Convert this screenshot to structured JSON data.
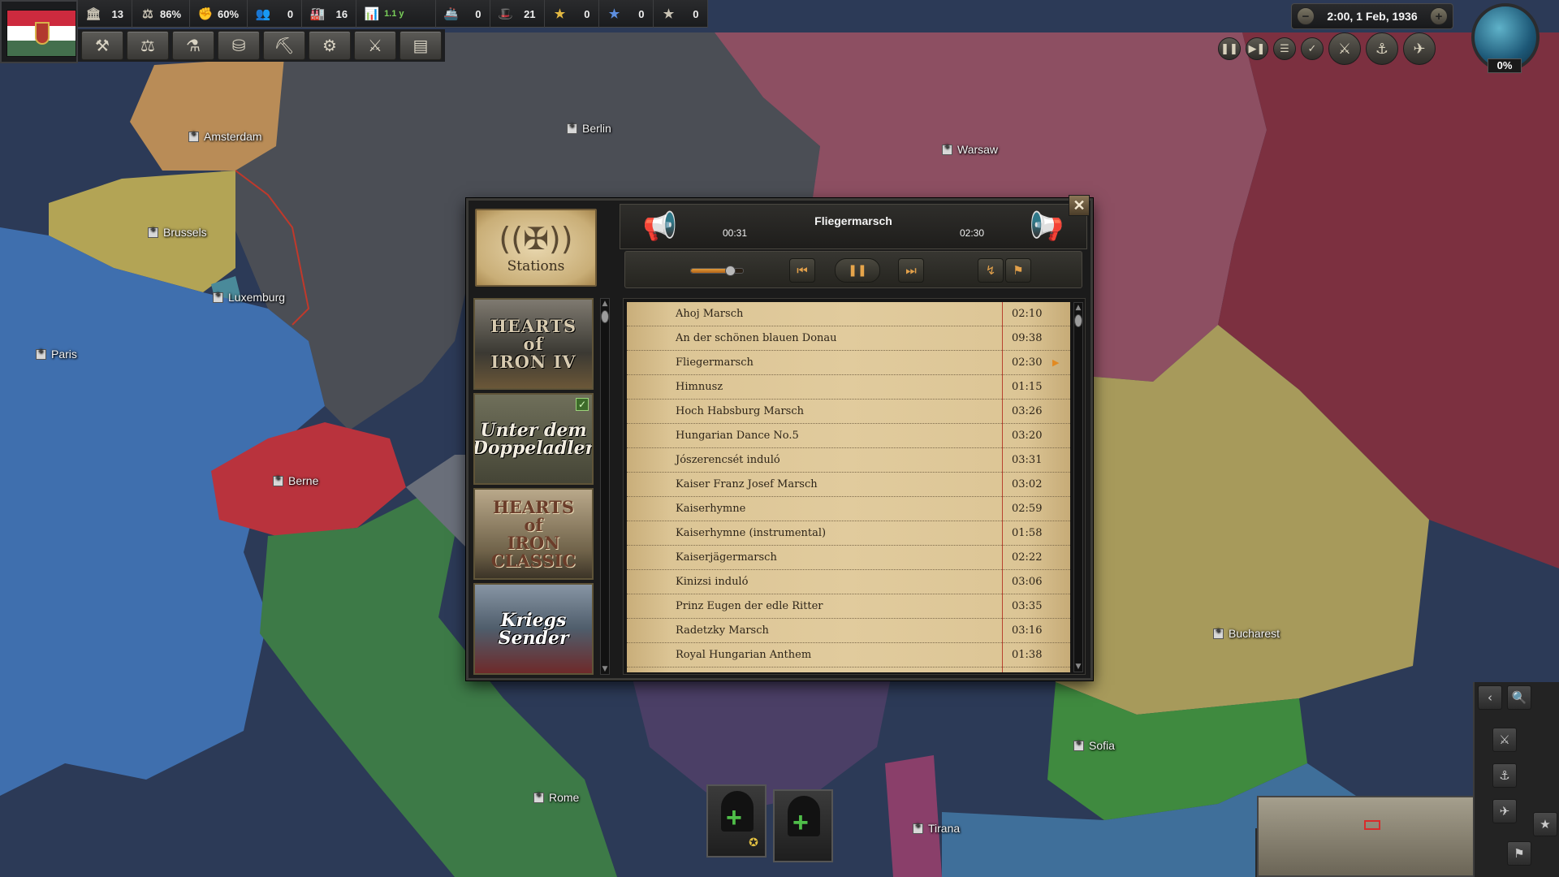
{
  "top_bar": {
    "resources": [
      {
        "name": "political-power",
        "icon": "🏛",
        "value": "13"
      },
      {
        "name": "stability",
        "icon": "⚖",
        "value": "86%"
      },
      {
        "name": "war-support",
        "icon": "✊",
        "value": "60%"
      },
      {
        "name": "manpower",
        "icon": "👥",
        "value": "0"
      },
      {
        "name": "factories",
        "icon": "🏭",
        "value": "16"
      },
      {
        "name": "equipment",
        "icon": "📊",
        "value": "",
        "extra": "1.1 y"
      },
      {
        "name": "convoys",
        "icon": "🚢",
        "value": "0"
      },
      {
        "name": "intelligence",
        "icon": "🎩",
        "value": "21"
      },
      {
        "name": "gold-star",
        "icon": "★",
        "value": "0"
      },
      {
        "name": "blue-star",
        "icon": "★",
        "value": "0"
      },
      {
        "name": "white-star",
        "icon": "★",
        "value": "0"
      }
    ],
    "toolbar_buttons": [
      "hammer-icon",
      "diplomacy-icon",
      "research-icon",
      "trade-icon",
      "construction-icon",
      "production-icon",
      "army-icon",
      "logistics-icon"
    ],
    "date": "2:00, 1 Feb, 1936",
    "globe_percent": "0%"
  },
  "cities": [
    {
      "name": "Amsterdam"
    },
    {
      "name": "Berlin"
    },
    {
      "name": "Warsaw"
    },
    {
      "name": "Brussels"
    },
    {
      "name": "Luxemburg"
    },
    {
      "name": "Paris"
    },
    {
      "name": "Berne"
    },
    {
      "name": "Bucharest"
    },
    {
      "name": "Sofia"
    },
    {
      "name": "Rome"
    },
    {
      "name": "Tirana"
    }
  ],
  "player": {
    "stations_label": "Stations",
    "stations": [
      {
        "title": "HEARTS\nof\nIRON IV",
        "active": false
      },
      {
        "title": "Unter dem\nDoppeladler",
        "active": true
      },
      {
        "title": "HEARTS\nof\nIRON\nCLASSIC",
        "active": false
      },
      {
        "title": "Kriegs\nSender",
        "active": false
      }
    ],
    "now_playing": "Fliegermarsch",
    "elapsed": "00:31",
    "duration": "02:30",
    "volume": 0.75,
    "close_label": "✕",
    "tracks": [
      {
        "title": "Ahoj Marsch",
        "duration": "02:10"
      },
      {
        "title": "An der schönen blauen Donau",
        "duration": "09:38"
      },
      {
        "title": "Fliegermarsch",
        "duration": "02:30",
        "playing": true
      },
      {
        "title": "Himnusz",
        "duration": "01:15"
      },
      {
        "title": "Hoch Habsburg Marsch",
        "duration": "03:26"
      },
      {
        "title": "Hungarian Dance No.5",
        "duration": "03:20"
      },
      {
        "title": "Jószerencsét induló",
        "duration": "03:31"
      },
      {
        "title": "Kaiser Franz Josef Marsch",
        "duration": "03:02"
      },
      {
        "title": "Kaiserhymne",
        "duration": "02:59"
      },
      {
        "title": "Kaiserhymne (instrumental)",
        "duration": "01:58"
      },
      {
        "title": "Kaiserjägermarsch",
        "duration": "02:22"
      },
      {
        "title": "Kinizsi induló",
        "duration": "03:06"
      },
      {
        "title": "Prinz Eugen der edle Ritter",
        "duration": "03:35"
      },
      {
        "title": "Radetzky Marsch",
        "duration": "03:16"
      },
      {
        "title": "Royal Hungarian Anthem",
        "duration": "01:38"
      }
    ]
  },
  "colors": {
    "germany": "#4b4e55",
    "poland": "#8d4f62",
    "france": "#3f6fae",
    "italy": "#3d7a47",
    "switzerland": "#b9333d",
    "romania": "#a79a5b",
    "netherlands": "#b98c57",
    "belgium": "#b3a455",
    "bulgaria": "#3f8a3f",
    "yugoslavia": "#4b3f66",
    "soviet": "#7c3040",
    "sea": "#2c3a57"
  }
}
